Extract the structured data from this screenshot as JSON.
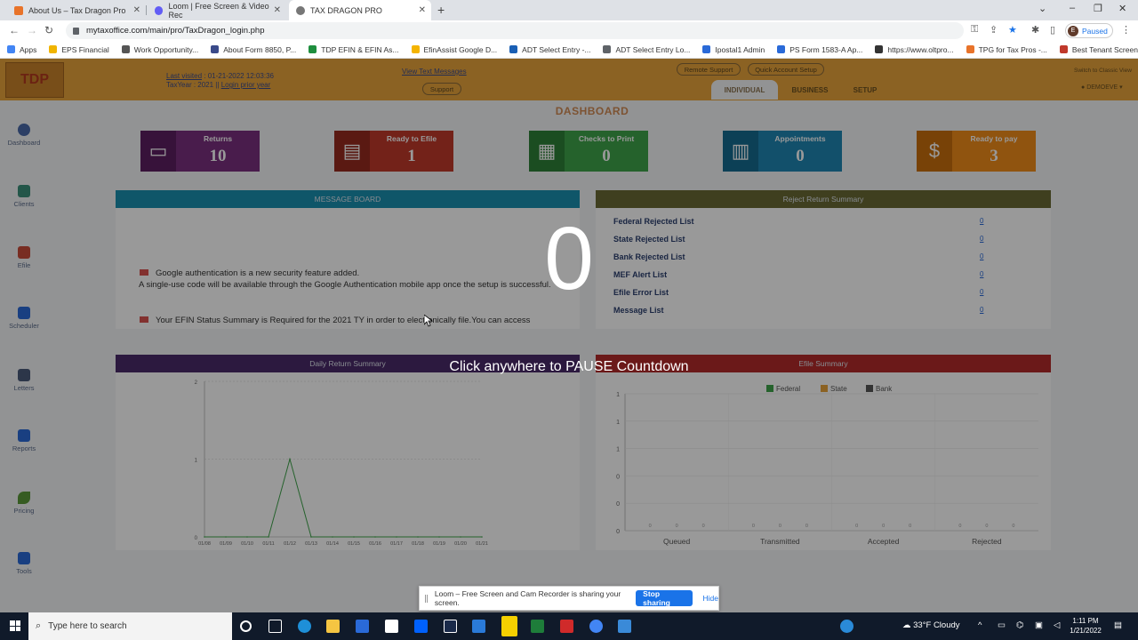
{
  "browser": {
    "tabs": [
      {
        "title": "About Us – Tax Dragon Pro",
        "favicon_color": "#e8732a"
      },
      {
        "title": "Loom | Free Screen & Video Rec",
        "favicon_color": "#625df5"
      },
      {
        "title": "TAX DRAGON PRO",
        "favicon_color": "#777777"
      }
    ],
    "url": "mytaxoffice.com/main/pro/TaxDragon_login.php",
    "profile_initial": "E",
    "profile_status": "Paused",
    "bookmarks": [
      {
        "label": "Apps",
        "color": "#4285f4"
      },
      {
        "label": "EPS Financial",
        "color": "#f0b400"
      },
      {
        "label": "Work Opportunity...",
        "color": "#555555"
      },
      {
        "label": "About Form 8850, P...",
        "color": "#3a4a8a"
      },
      {
        "label": "TDP EFIN & EFIN As...",
        "color": "#1e8e3e"
      },
      {
        "label": "EfinAssist Google D...",
        "color": "#f4b400"
      },
      {
        "label": "ADT Select Entry -...",
        "color": "#1a5fb4"
      },
      {
        "label": "ADT Select Entry Lo...",
        "color": "#5f6368"
      },
      {
        "label": "Ipostal1 Admin",
        "color": "#2a6ad8"
      },
      {
        "label": "PS Form 1583-A Ap...",
        "color": "#2a6ad8"
      },
      {
        "label": "https://www.oltpro...",
        "color": "#333333"
      },
      {
        "label": "TPG for Tax Pros -...",
        "color": "#e8732a"
      },
      {
        "label": "Best Tenant Screeni...",
        "color": "#c0392b"
      }
    ]
  },
  "app": {
    "logo_text": "TDP",
    "header": {
      "last_visited_label": "Last visited",
      "last_visited_value": ": 01-21-2022 12:03:36",
      "tax_year_label": "TaxYear : 2021",
      "login_prior_year": "Login prior year",
      "view_text_messages": "View Text Messages",
      "support": "Support",
      "remote_support": "Remote Support",
      "quick_account_setup": "Quick Account Setup",
      "switch_view": "Switch to Classic View",
      "user": "DEMOEVE",
      "tabs": [
        "INDIVIDUAL",
        "BUSINESS",
        "SETUP"
      ]
    },
    "sidebar": [
      "Dashboard",
      "Clients",
      "Efile",
      "Scheduler",
      "Letters",
      "Reports",
      "Pricing",
      "Tools"
    ],
    "dashboard_title": "DASHBOARD",
    "stats": [
      {
        "label": "Returns",
        "value": "10",
        "color": "#7a2f7f",
        "icon_color": "#5c1f61"
      },
      {
        "label": "Ready to Efile",
        "value": "1",
        "color": "#c0392b",
        "icon_color": "#962a1f"
      },
      {
        "label": "Checks to Print",
        "value": "0",
        "color": "#3ea34a",
        "icon_color": "#2e8038"
      },
      {
        "label": "Appointments",
        "value": "0",
        "color": "#1f86b3",
        "icon_color": "#156b90"
      },
      {
        "label": "Ready to pay",
        "value": "3",
        "color": "#f08c1a",
        "icon_color": "#c86f0d",
        "icon": "$"
      }
    ],
    "message_board": {
      "title": "MESSAGE BOARD",
      "messages": [
        "Google authentication is a new security feature added.",
        "A single-use code will be available through the Google Authentication mobile app once the setup is successful.",
        "Your EFIN Status Summary is Required for the 2021 TY in order to electronically file.You can access"
      ]
    },
    "reject_summary": {
      "title": "Reject Return Summary",
      "rows": [
        {
          "label": "Federal Rejected List",
          "value": "0"
        },
        {
          "label": "State Rejected List",
          "value": "0"
        },
        {
          "label": "Bank Rejected List",
          "value": "0"
        },
        {
          "label": "MEF Alert List",
          "value": "0"
        },
        {
          "label": "Efile Error List",
          "value": "0"
        },
        {
          "label": "Message List",
          "value": "0"
        }
      ]
    },
    "daily_title": "Daily Return Summary",
    "efile_title": "Efile Summary",
    "daily_color": "#4a2a6a",
    "efile_color": "#b22b2b",
    "mb_color": "#1a8fb0",
    "rj_color": "#6a6a35"
  },
  "chart_data": [
    {
      "type": "line",
      "title": "Daily Return Summary",
      "x": [
        "01/08",
        "01/09",
        "01/10",
        "01/11",
        "01/12",
        "01/13",
        "01/14",
        "01/15",
        "01/16",
        "01/17",
        "01/18",
        "01/19",
        "01/20",
        "01/21"
      ],
      "series": [
        {
          "values": [
            0,
            0,
            0,
            0,
            1,
            0,
            0,
            0,
            0,
            0,
            0,
            0,
            0,
            0
          ]
        }
      ],
      "yticks": [
        "2",
        "1",
        "0"
      ],
      "ylim": [
        0,
        2
      ],
      "grid": true,
      "series_color": "#3ea34a"
    },
    {
      "type": "bar",
      "title": "Efile Summary",
      "categories": [
        "Queued",
        "Transmitted",
        "Accepted",
        "Rejected"
      ],
      "series": [
        {
          "name": "Federal",
          "values": [
            0,
            0,
            0,
            0
          ],
          "color": "#3ea34a"
        },
        {
          "name": "State",
          "values": [
            0,
            0,
            0,
            0
          ],
          "color": "#e8a33b"
        },
        {
          "name": "Bank",
          "values": [
            0,
            0,
            0,
            0
          ],
          "color": "#555555"
        }
      ],
      "yticks": [
        "1",
        "1",
        "1",
        "0",
        "0",
        "0"
      ],
      "legend": "top-right",
      "grid": true
    }
  ],
  "overlay": {
    "countdown": "0",
    "pause_text": "Click anywhere to PAUSE Countdown"
  },
  "loom": {
    "message": "Loom – Free Screen and Cam Recorder is sharing your screen.",
    "stop": "Stop sharing",
    "hide": "Hide"
  },
  "taskbar": {
    "search_placeholder": "Type here to search",
    "weather": "33°F  Cloudy",
    "time": "1:11 PM",
    "date": "1/21/2022"
  }
}
